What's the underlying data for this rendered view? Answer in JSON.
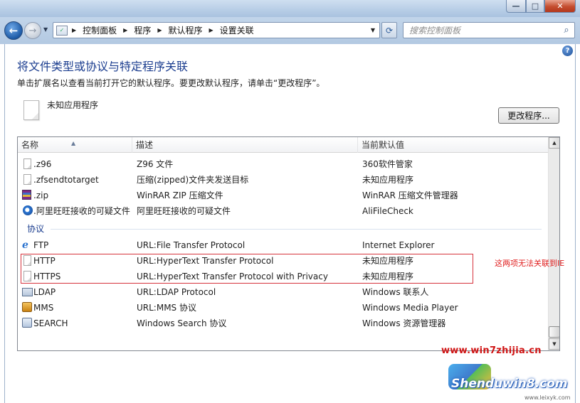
{
  "window": {
    "caption_buttons": {
      "minimize": "—",
      "maximize": "□",
      "close": "✕"
    }
  },
  "nav": {
    "back_glyph": "←",
    "forward_glyph": "→",
    "breadcrumbs": [
      "控制面板",
      "程序",
      "默认程序",
      "设置关联"
    ],
    "search_placeholder": "搜索控制面板",
    "icons": {
      "back": "back-arrow-icon",
      "forward": "forward-arrow-icon",
      "refresh": "refresh-icon",
      "search": "search-icon"
    }
  },
  "page": {
    "title": "将文件类型或协议与特定程序关联",
    "instructions": "单击扩展名以查看当前打开它的默认程序。要更改默认程序，请单击“更改程序”。",
    "current_app": "未知应用程序",
    "change_button": "更改程序...",
    "help_glyph": "?"
  },
  "list": {
    "columns": [
      "名称",
      "描述",
      "当前默认值"
    ],
    "rows_files": [
      {
        "icon": "file-icon",
        "name": ".z96",
        "desc": "Z96 文件",
        "default": "360软件管家"
      },
      {
        "icon": "file-icon",
        "name": ".zfsendtotarget",
        "desc": "压缩(zipped)文件夹发送目标",
        "default": "未知应用程序"
      },
      {
        "icon": "winrar-icon",
        "name": ".zip",
        "desc": "WinRAR ZIP 压缩文件",
        "default": "WinRAR 压缩文件管理器"
      },
      {
        "icon": "alifilecheck-icon",
        "name": ".阿里旺旺接收的可疑文件",
        "desc": "阿里旺旺接收的可疑文件",
        "default": "AliFileCheck"
      }
    ],
    "group_label": "协议",
    "rows_protocols": [
      {
        "icon": "internet-explorer-icon",
        "name": "FTP",
        "desc": "URL:File Transfer Protocol",
        "default": "Internet Explorer"
      },
      {
        "icon": "file-icon",
        "name": "HTTP",
        "desc": "URL:HyperText Transfer Protocol",
        "default": "未知应用程序"
      },
      {
        "icon": "file-icon",
        "name": "HTTPS",
        "desc": "URL:HyperText Transfer Protocol with Privacy",
        "default": "未知应用程序"
      },
      {
        "icon": "contact-card-icon",
        "name": "LDAP",
        "desc": "URL:LDAP Protocol",
        "default": "Windows 联系人"
      },
      {
        "icon": "media-player-icon",
        "name": "MMS",
        "desc": "URL:MMS 协议",
        "default": "Windows Media Player"
      },
      {
        "icon": "search-app-icon",
        "name": "SEARCH",
        "desc": "Windows Search 协议",
        "default": "Windows 资源管理器"
      }
    ]
  },
  "annotation": {
    "text": "这两项无法关联到IE",
    "color": "#e02020"
  },
  "watermark": {
    "url": "www.win7zhijia.cn",
    "brand": "Shenduwin8.com",
    "sub": "www.leixyk.com"
  },
  "colors": {
    "title_blue": "#1b3d8f",
    "annotation_red": "#d6333d",
    "chrome_blue": "#b7cde6"
  }
}
